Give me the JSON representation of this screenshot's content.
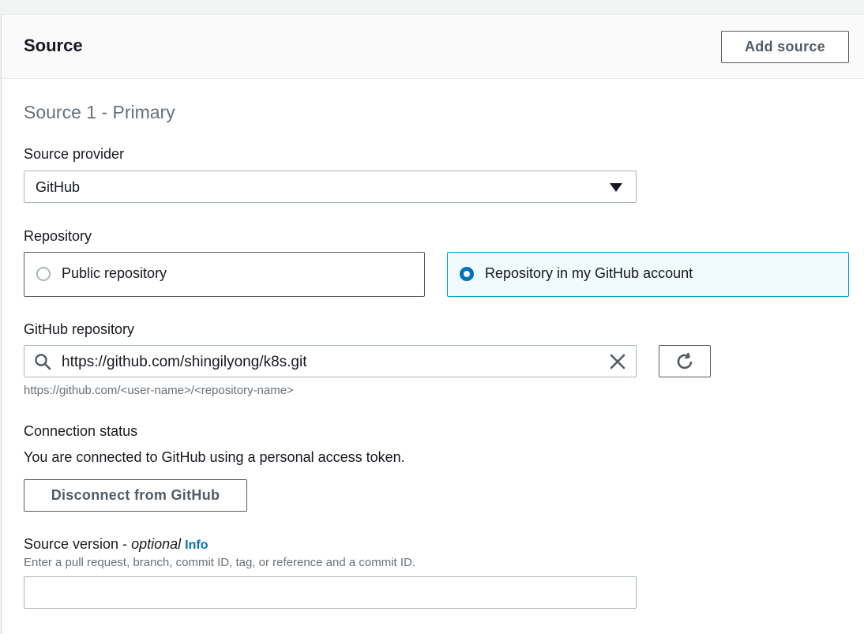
{
  "section": {
    "title": "Source",
    "add_button": "Add source",
    "subtitle": "Source 1 - Primary"
  },
  "source_provider": {
    "label": "Source provider",
    "selected": "GitHub"
  },
  "repository": {
    "label": "Repository",
    "options": [
      {
        "label": "Public repository",
        "checked": false
      },
      {
        "label": "Repository in my GitHub account",
        "checked": true
      }
    ]
  },
  "github_repository": {
    "label": "GitHub repository",
    "value": "https://github.com/shingilyong/k8s.git",
    "hint": "https://github.com/<user-name>/<repository-name>",
    "icons": {
      "search": "search-icon",
      "clear": "close-icon",
      "refresh": "refresh-icon"
    }
  },
  "connection": {
    "label": "Connection status",
    "status_text": "You are connected to GitHub using a personal access token.",
    "disconnect_button": "Disconnect from GitHub"
  },
  "source_version": {
    "label": "Source version",
    "separator": " - ",
    "optional": "optional",
    "info_link": "Info",
    "description": "Enter a pull request, branch, commit ID, tag, or reference and a commit ID.",
    "value": ""
  },
  "colors": {
    "accent": "#0073bb",
    "selected_tile_bg": "#f1faff",
    "selected_tile_border": "#00a1c9"
  }
}
